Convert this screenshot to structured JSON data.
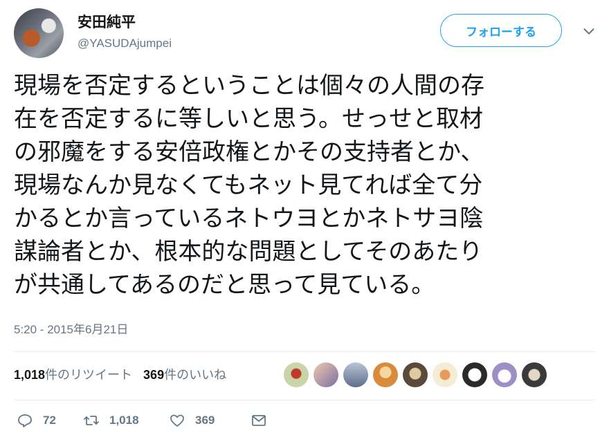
{
  "user": {
    "name": "安田純平",
    "handle": "@YASUDAjumpei"
  },
  "follow_button_label": "フォローする",
  "tweet_lines": [
    "現場を否定するということは個々の人間の存",
    "在を否定するに等しいと思う。せっせと取材",
    "の邪魔をする安倍政権とかその支持者とか、",
    "現場なんか見なくてもネット見てれば全て分",
    "かるとか言っているネトウヨとかネトサヨ陰",
    "謀論者とか、根本的な問題としてそのあたり",
    "が共通してあるのだと思って見ている。"
  ],
  "timestamp": "5:20 - 2015年6月21日",
  "stats": {
    "retweets_count": "1,018",
    "retweets_label": "件のリツイート",
    "likes_count": "369",
    "likes_label": "件のいいね"
  },
  "liker_avatar_colors": [
    "#c9d4a8",
    "#7a6fa0",
    "#8a9bb5",
    "#d98a3a",
    "#b5a078",
    "#e8dcb8",
    "#2a2a2a",
    "#9b8fc4",
    "#3a3a3a"
  ],
  "actions": {
    "reply_count": "72",
    "retweet_count": "1,018",
    "like_count": "369"
  },
  "colors": {
    "accent": "#1da1f2",
    "secondary_text": "#657786",
    "text": "#14171a"
  }
}
